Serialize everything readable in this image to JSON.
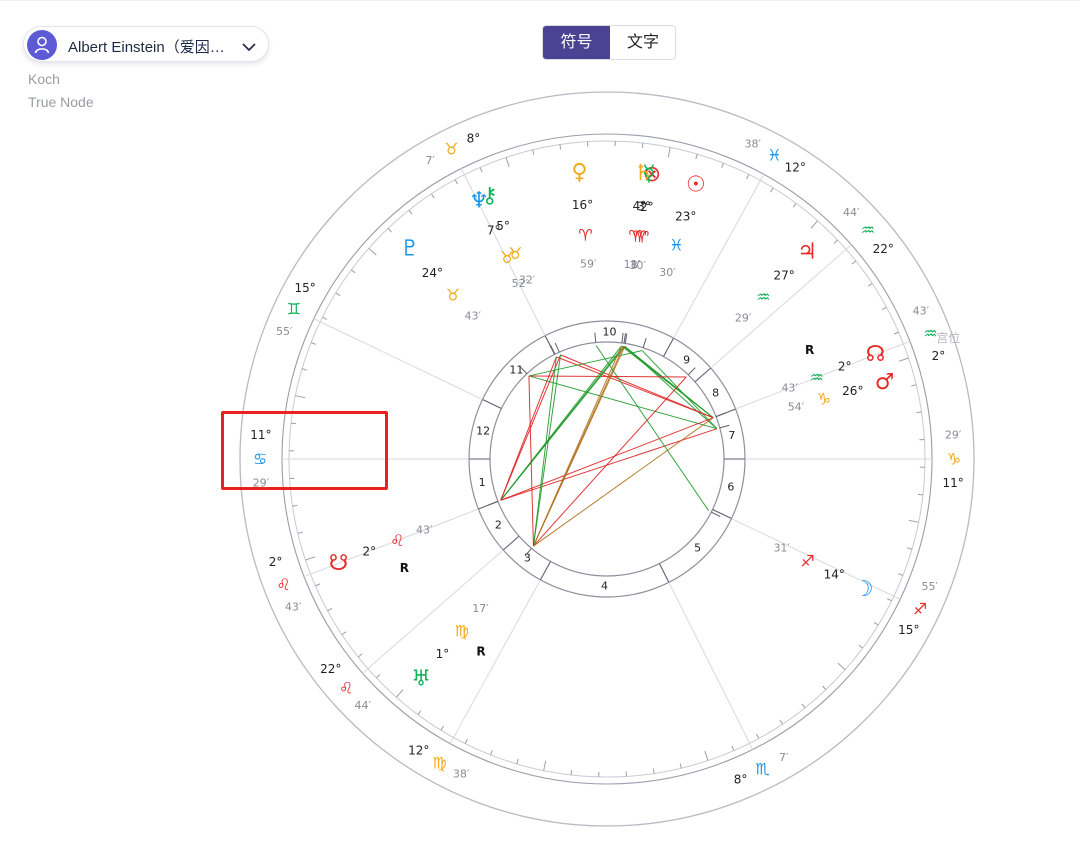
{
  "person": {
    "name": "Albert Einstein（爱因…"
  },
  "meta": {
    "house_system": "Koch",
    "node_type": "True Node"
  },
  "toggle": {
    "active": "符号",
    "inactive": "文字"
  },
  "colors": {
    "fire": "#e52a27",
    "earth": "#f4a81c",
    "air": "#12b157",
    "water": "#1a96e8",
    "aspect_red": "#e02020",
    "aspect_green": "#1f9a2a",
    "aspect_blue": "#3a7fc4",
    "aspect_orange": "#f4a81c",
    "aspect_brown": "#b0701c",
    "accent": "#4a4293"
  },
  "sign_glyphs": [
    "♈",
    "♉",
    "♊",
    "♋",
    "♌",
    "♍",
    "♎",
    "♏",
    "♐",
    "♑",
    "♒",
    "♓"
  ],
  "chart_data": {
    "type": "natal-chart-wheel",
    "house_cusps": [
      {
        "house": 1,
        "sign": "♋",
        "deg": "11°",
        "min": "29′"
      },
      {
        "house": 2,
        "sign": "♌",
        "deg": "2°",
        "min": "43′"
      },
      {
        "house": 3,
        "sign": "♌",
        "deg": "22°",
        "min": "44′"
      },
      {
        "house": 4,
        "sign": "♍",
        "deg": "12°",
        "min": "38′"
      },
      {
        "house": 5,
        "sign": "♏",
        "deg": "8°",
        "min": "7′"
      },
      {
        "house": 6,
        "sign": "♐",
        "deg": "15°",
        "min": "55′"
      },
      {
        "house": 7,
        "sign": "♑",
        "deg": "11°",
        "min": "29′"
      },
      {
        "house": 8,
        "sign": "♒",
        "deg": "2°",
        "min": "43′"
      },
      {
        "house": 9,
        "sign": "♒",
        "deg": "22°",
        "min": "44′"
      },
      {
        "house": 10,
        "sign": "♓",
        "deg": "12°",
        "min": "38′"
      },
      {
        "house": 11,
        "sign": "♉",
        "deg": "8°",
        "min": "7′"
      },
      {
        "house": 12,
        "sign": "♊",
        "deg": "15°",
        "min": "55′"
      }
    ],
    "planets": [
      {
        "name": "Mars",
        "glyph": "♂",
        "deg": "26°",
        "min": "54′",
        "sign": "♑",
        "retro": false
      },
      {
        "name": "Node",
        "glyph": "☊",
        "deg": "2°",
        "min": "43′",
        "sign": "♒",
        "retro": true
      },
      {
        "name": "Jupiter",
        "glyph": "♃",
        "deg": "27°",
        "min": "29′",
        "sign": "♒",
        "retro": false
      },
      {
        "name": "Sun",
        "glyph": "☉",
        "deg": "23°",
        "min": "30′",
        "sign": "♓",
        "retro": false
      },
      {
        "name": "PartFortune",
        "glyph": "⊗",
        "deg": "2°",
        "min": "30′",
        "sign": "♈",
        "retro": false
      },
      {
        "name": "Mercury",
        "glyph": "☿",
        "deg": "3°",
        "min": "8′",
        "sign": "♈",
        "retro": false
      },
      {
        "name": "Saturn",
        "glyph": "♄",
        "deg": "4°",
        "min": "11′",
        "sign": "♈",
        "retro": false
      },
      {
        "name": "Venus",
        "glyph": "♀",
        "deg": "16°",
        "min": "59′",
        "sign": "♈",
        "retro": false
      },
      {
        "name": "Chiron",
        "glyph": "⚷",
        "deg": "5°",
        "min": "32′",
        "sign": "♉",
        "retro": false
      },
      {
        "name": "Neptune",
        "glyph": "♆",
        "deg": "7°",
        "min": "52′",
        "sign": "♉",
        "retro": false
      },
      {
        "name": "Pluto",
        "glyph": "♇",
        "deg": "24°",
        "min": "43′",
        "sign": "♉",
        "retro": false
      },
      {
        "name": "SouthNode",
        "glyph": "☋",
        "deg": "2°",
        "min": "43′",
        "sign": "♌",
        "retro": true
      },
      {
        "name": "Uranus",
        "glyph": "♅",
        "deg": "1°",
        "min": "17′",
        "sign": "♍",
        "retro": true
      },
      {
        "name": "Moon",
        "glyph": "☽",
        "deg": "14°",
        "min": "31′",
        "sign": "♐",
        "retro": false
      }
    ],
    "aspect_lines_shown": true,
    "ascendant_highlighted": true
  },
  "labels": {
    "side_tag": "宫位",
    "retro": "R"
  }
}
